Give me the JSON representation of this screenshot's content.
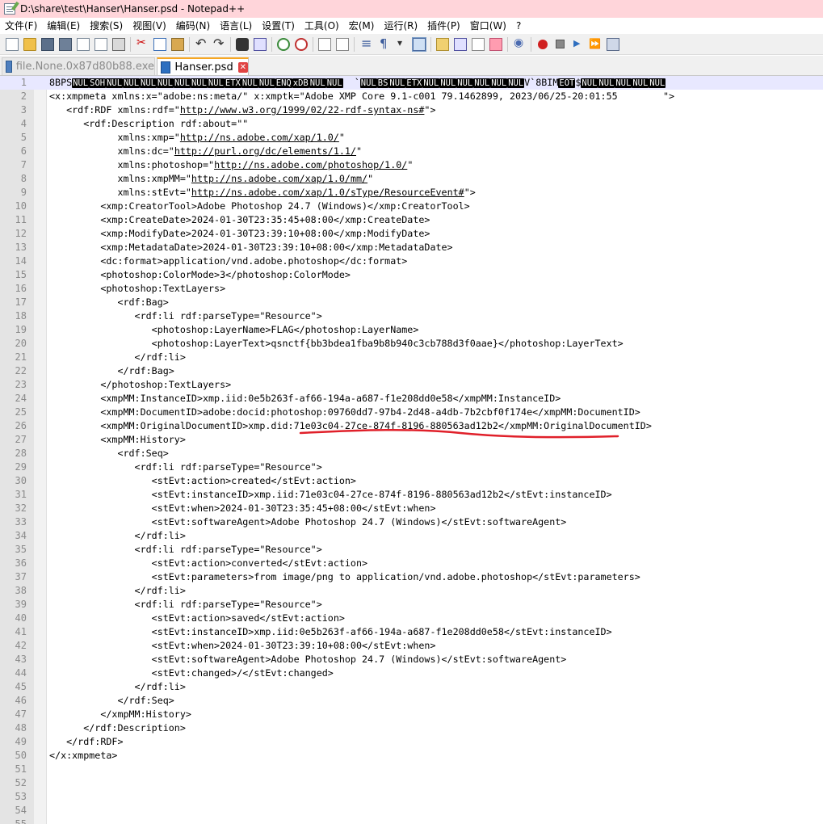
{
  "window": {
    "title": "D:\\share\\test\\Hanser\\Hanser.psd - Notepad++"
  },
  "menu": {
    "items": [
      "文件(F)",
      "编辑(E)",
      "搜索(S)",
      "视图(V)",
      "编码(N)",
      "语言(L)",
      "设置(T)",
      "工具(O)",
      "宏(M)",
      "运行(R)",
      "插件(P)",
      "窗口(W)",
      "?"
    ]
  },
  "toolbar": {
    "icons": [
      "new-file-icon",
      "open-folder-icon",
      "save-icon",
      "save-all-icon",
      "close-icon",
      "close-all-icon",
      "print-icon",
      "sep",
      "cut-icon",
      "copy-icon",
      "paste-icon",
      "sep",
      "undo-icon",
      "redo-icon",
      "sep",
      "find-icon",
      "replace-icon",
      "sep",
      "zoom-in-icon",
      "zoom-out-icon",
      "sep",
      "sync-vertical-icon",
      "sync-horizontal-icon",
      "sep",
      "word-wrap-icon",
      "show-all-chars-icon",
      "dropdown-icon",
      "indent-guide-icon",
      "sep",
      "document-map-icon",
      "function-list-icon",
      "folder-workspace-icon",
      "monitoring-icon",
      "sep",
      "eye-icon",
      "sep",
      "record-macro-icon",
      "stop-macro-icon",
      "play-macro-icon",
      "run-macro-multiple-icon",
      "save-macro-icon"
    ]
  },
  "tabs": [
    {
      "label": "file.None.0x87d80b88.exe"
    },
    {
      "label": "Hanser.psd",
      "close": "✕"
    }
  ],
  "editor": {
    "line1": [
      {
        "t": "8BPS"
      },
      {
        "c": "NUL"
      },
      {
        "c": "SOH"
      },
      {
        "c": "NUL"
      },
      {
        "c": "NUL"
      },
      {
        "c": "NUL"
      },
      {
        "c": "NUL"
      },
      {
        "c": "NUL"
      },
      {
        "c": "NUL"
      },
      {
        "c": "NUL"
      },
      {
        "c": "ETX"
      },
      {
        "c": "NUL"
      },
      {
        "c": "NUL"
      },
      {
        "c": "ENQ"
      },
      {
        "c": "xDB"
      },
      {
        "c": "NUL"
      },
      {
        "c": "NUL"
      },
      {
        "t": "  `"
      },
      {
        "c": "NUL"
      },
      {
        "c": "BS"
      },
      {
        "c": "NUL"
      },
      {
        "c": "ETX"
      },
      {
        "c": "NUL"
      },
      {
        "c": "NUL"
      },
      {
        "c": "NUL"
      },
      {
        "c": "NUL"
      },
      {
        "c": "NUL"
      },
      {
        "c": "NUL"
      },
      {
        "t": "V`8BIM"
      },
      {
        "c": "EOT"
      },
      {
        "t": "$"
      },
      {
        "c": "NUL"
      },
      {
        "c": "NUL"
      },
      {
        "c": "NUL"
      },
      {
        "c": "NUL"
      },
      {
        "c": "NUL"
      }
    ],
    "lines": [
      "<x:xmpmeta xmlns:x=\"adobe:ns:meta/\" x:xmptk=\"Adobe XMP Core 9.1-c001 79.1462899, 2023/06/25-20:01:55        \">",
      "   <rdf:RDF xmlns:rdf=\"http://www.w3.org/1999/02/22-rdf-syntax-ns#\">",
      "      <rdf:Description rdf:about=\"\"",
      "            xmlns:xmp=\"http://ns.adobe.com/xap/1.0/\"",
      "            xmlns:dc=\"http://purl.org/dc/elements/1.1/\"",
      "            xmlns:photoshop=\"http://ns.adobe.com/photoshop/1.0/\"",
      "            xmlns:xmpMM=\"http://ns.adobe.com/xap/1.0/mm/\"",
      "            xmlns:stEvt=\"http://ns.adobe.com/xap/1.0/sType/ResourceEvent#\">",
      "         <xmp:CreatorTool>Adobe Photoshop 24.7 (Windows)</xmp:CreatorTool>",
      "         <xmp:CreateDate>2024-01-30T23:35:45+08:00</xmp:CreateDate>",
      "         <xmp:ModifyDate>2024-01-30T23:39:10+08:00</xmp:ModifyDate>",
      "         <xmp:MetadataDate>2024-01-30T23:39:10+08:00</xmp:MetadataDate>",
      "         <dc:format>application/vnd.adobe.photoshop</dc:format>",
      "         <photoshop:ColorMode>3</photoshop:ColorMode>",
      "         <photoshop:TextLayers>",
      "            <rdf:Bag>",
      "               <rdf:li rdf:parseType=\"Resource\">",
      "                  <photoshop:LayerName>FLAG</photoshop:LayerName>",
      "                  <photoshop:LayerText>qsnctf{bb3bdea1fba9b8b940c3cb788d3f0aae}</photoshop:LayerText>",
      "               </rdf:li>",
      "            </rdf:Bag>",
      "         </photoshop:TextLayers>",
      "         <xmpMM:InstanceID>xmp.iid:0e5b263f-af66-194a-a687-f1e208dd0e58</xmpMM:InstanceID>",
      "         <xmpMM:DocumentID>adobe:docid:photoshop:09760dd7-97b4-2d48-a4db-7b2cbf0f174e</xmpMM:DocumentID>",
      "         <xmpMM:OriginalDocumentID>xmp.did:71e03c04-27ce-874f-8196-880563ad12b2</xmpMM:OriginalDocumentID>",
      "         <xmpMM:History>",
      "            <rdf:Seq>",
      "               <rdf:li rdf:parseType=\"Resource\">",
      "                  <stEvt:action>created</stEvt:action>",
      "                  <stEvt:instanceID>xmp.iid:71e03c04-27ce-874f-8196-880563ad12b2</stEvt:instanceID>",
      "                  <stEvt:when>2024-01-30T23:35:45+08:00</stEvt:when>",
      "                  <stEvt:softwareAgent>Adobe Photoshop 24.7 (Windows)</stEvt:softwareAgent>",
      "               </rdf:li>",
      "               <rdf:li rdf:parseType=\"Resource\">",
      "                  <stEvt:action>converted</stEvt:action>",
      "                  <stEvt:parameters>from image/png to application/vnd.adobe.photoshop</stEvt:parameters>",
      "               </rdf:li>",
      "               <rdf:li rdf:parseType=\"Resource\">",
      "                  <stEvt:action>saved</stEvt:action>",
      "                  <stEvt:instanceID>xmp.iid:0e5b263f-af66-194a-a687-f1e208dd0e58</stEvt:instanceID>",
      "                  <stEvt:when>2024-01-30T23:39:10+08:00</stEvt:when>",
      "                  <stEvt:softwareAgent>Adobe Photoshop 24.7 (Windows)</stEvt:softwareAgent>",
      "                  <stEvt:changed>/</stEvt:changed>",
      "               </rdf:li>",
      "            </rdf:Seq>",
      "         </xmpMM:History>",
      "      </rdf:Description>",
      "   </rdf:RDF>",
      "</x:xmpmeta>",
      "",
      "",
      "",
      "",
      ""
    ],
    "annotation_color": "#e0202a"
  }
}
